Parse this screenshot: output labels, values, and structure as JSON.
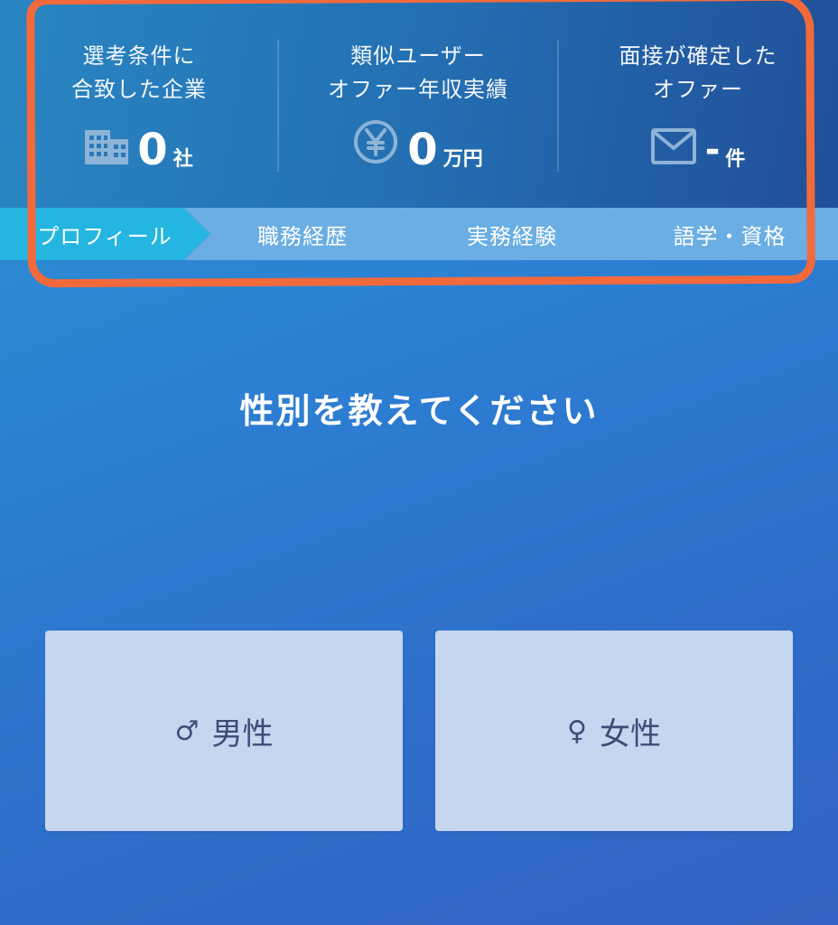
{
  "stats": [
    {
      "label_line1": "選考条件に",
      "label_line2": "合致した企業",
      "value": "0",
      "unit": "社",
      "icon": "building-icon"
    },
    {
      "label_line1": "類似ユーザー",
      "label_line2": "オファー年収実績",
      "value": "0",
      "unit": "万円",
      "icon": "yen-icon"
    },
    {
      "label_line1": "面接が確定した",
      "label_line2": "オファー",
      "value": "-",
      "unit": "件",
      "icon": "mail-icon"
    }
  ],
  "steps": [
    {
      "label": "プロフィール",
      "active": true
    },
    {
      "label": "職務経歴",
      "active": false
    },
    {
      "label": "実務経験",
      "active": false
    },
    {
      "label": "語学・資格",
      "active": false
    }
  ],
  "question": "性別を教えてください",
  "options": {
    "male": {
      "symbol": "♂",
      "label": "男性"
    },
    "female": {
      "symbol": "♀",
      "label": "女性"
    }
  },
  "colors": {
    "active_step": "#24b6e0",
    "inactive_step": "#6aaee3",
    "option_bg": "#c5d6ee",
    "option_text": "#3c4d78",
    "highlight": "#f26a3c"
  }
}
